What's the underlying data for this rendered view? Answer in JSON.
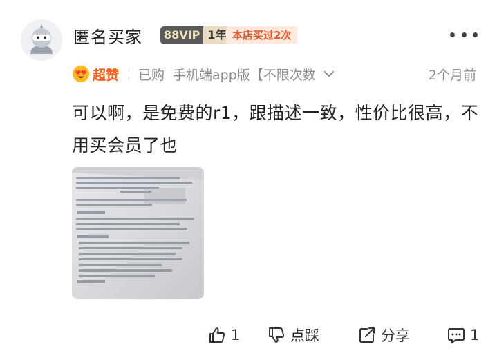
{
  "user": {
    "name": "匿名买家",
    "vip_label": "88VIP",
    "years_label": "1年",
    "repeat_label": "本店买过2次"
  },
  "review": {
    "rating_label": "超赞",
    "purchase_status": "已购",
    "sku": "手机端app版【不限次数",
    "time": "2个月前",
    "text": "可以啊，是免费的r1，跟描述一致，性价比很高，不用买会员了也"
  },
  "actions": {
    "like_count": "1",
    "dislike_label": "点踩",
    "share_label": "分享",
    "comment_count": "1"
  },
  "colors": {
    "accent": "#ff5d17",
    "repeat_badge_text": "#e35a2b",
    "repeat_badge_bg": "#fde9dd",
    "vip_bg": "#5a5a5a",
    "muted_text": "#8c8c8c"
  },
  "icons": [
    "avatar-ninja-icon",
    "heart-eyes-emoji-icon",
    "chevron-down-icon",
    "more-dots-icon",
    "thumbs-up-icon",
    "thumbs-down-icon",
    "share-icon",
    "comment-icon"
  ]
}
